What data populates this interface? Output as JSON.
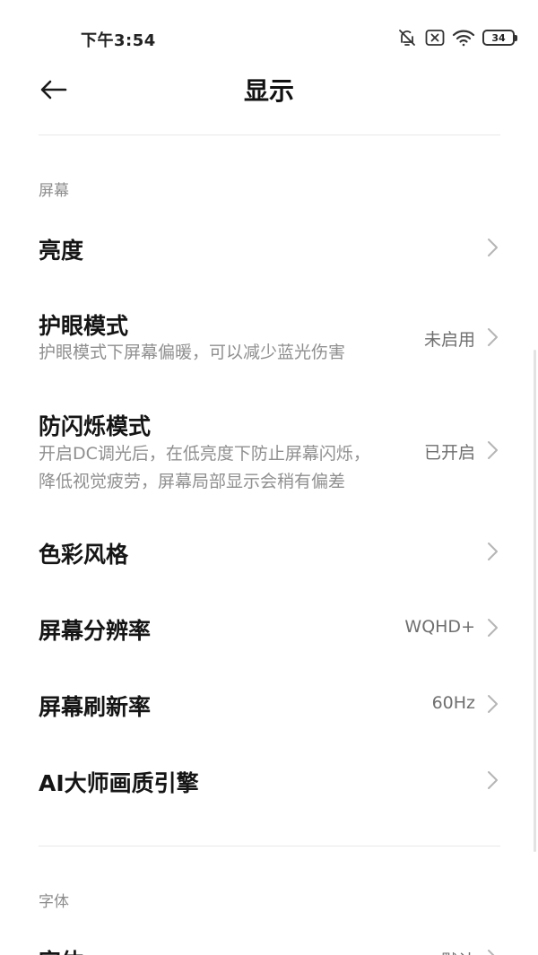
{
  "status_bar": {
    "time": "下午3:54",
    "battery_level": "34",
    "icons": [
      "bell-off-icon",
      "close-box-icon",
      "wifi-icon",
      "battery-icon"
    ]
  },
  "header": {
    "back_icon": "arrow-left-icon",
    "title": "显示"
  },
  "sections": {
    "screen": {
      "label": "屏幕"
    },
    "font": {
      "label": "字体"
    }
  },
  "rows": {
    "brightness": {
      "title": "亮度"
    },
    "eye_care": {
      "title": "护眼模式",
      "description": "护眼模式下屏幕偏暖，可以减少蓝光伤害",
      "value": "未启用"
    },
    "anti_flicker": {
      "title": "防闪烁模式",
      "description_line1": "开启DC调光后，在低亮度下防止屏幕闪烁，",
      "description_line2": "降低视觉疲劳，屏幕局部显示会稍有偏差",
      "value": "已开启"
    },
    "color_style": {
      "title": "色彩风格"
    },
    "resolution": {
      "title": "屏幕分辨率",
      "value": "WQHD+"
    },
    "refresh_rate": {
      "title": "屏幕刷新率",
      "value": "60Hz"
    },
    "ai_engine": {
      "title": "AI大师画质引擎"
    },
    "font": {
      "title": "字体",
      "value": "默认"
    }
  },
  "colors": {
    "title_text": "#151515",
    "secondary_text": "#8f8f8f",
    "value_text": "#6f6f6f",
    "divider": "#e8e8e8",
    "chevron": "#b5b5b5"
  }
}
